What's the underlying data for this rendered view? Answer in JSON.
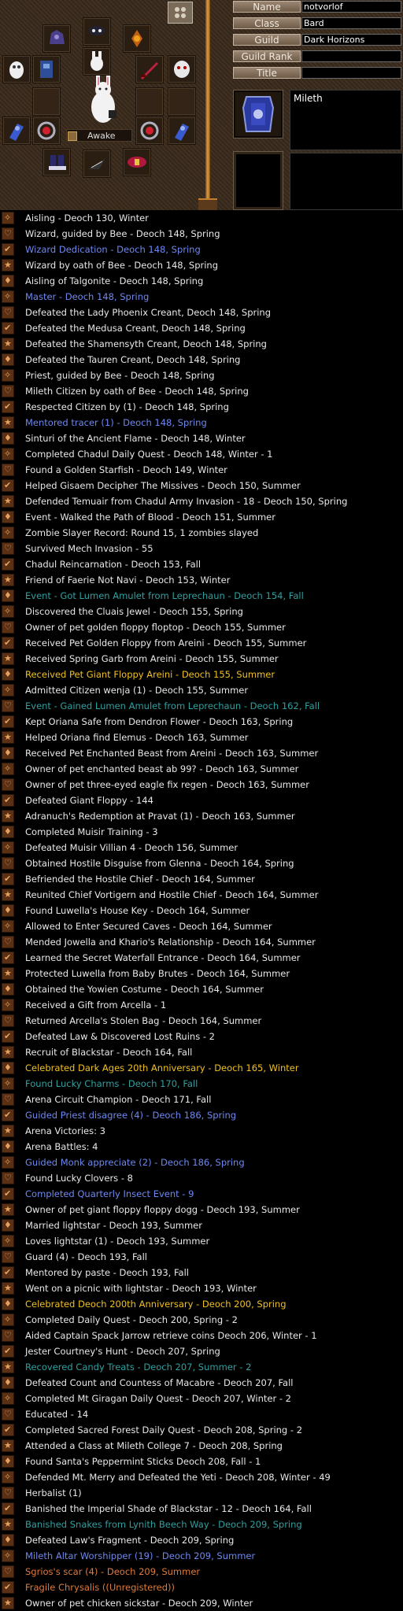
{
  "profile": {
    "labels": {
      "name": "Name",
      "class": "Class",
      "guild": "Guild",
      "guild_rank": "Guild Rank",
      "title": "Title"
    },
    "values": {
      "name": "notvorlof",
      "class": "Bard",
      "guild": "Dark Horizons",
      "guild_rank": "",
      "title": ""
    },
    "nation": "Mileth",
    "status": "Awake"
  },
  "legend": [
    {
      "text": "Aisling - Deoch 130, Winter",
      "color": "w"
    },
    {
      "text": "Wizard, guided by Bee - Deoch 148, Spring",
      "color": "w"
    },
    {
      "text": "Wizard Dedication - Deoch 148, Spring",
      "color": "b"
    },
    {
      "text": "Wizard by oath of Bee - Deoch 148, Spring",
      "color": "w"
    },
    {
      "text": "Aisling of Talgonite - Deoch 148, Spring",
      "color": "w"
    },
    {
      "text": "Master - Deoch 148, Spring",
      "color": "b"
    },
    {
      "text": "Defeated the Lady Phoenix Creant, Deoch 148, Spring",
      "color": "w"
    },
    {
      "text": "Defeated the Medusa Creant, Deoch 148, Spring",
      "color": "w"
    },
    {
      "text": "Defeated the Shamensyth Creant, Deoch 148, Spring",
      "color": "w"
    },
    {
      "text": "Defeated the Tauren Creant, Deoch 148, Spring",
      "color": "w"
    },
    {
      "text": "Priest, guided by Bee - Deoch 148, Spring",
      "color": "w"
    },
    {
      "text": "Mileth Citizen by oath of Bee - Deoch 148, Spring",
      "color": "w"
    },
    {
      "text": "Respected Citizen by  (1) - Deoch 148, Spring",
      "color": "w"
    },
    {
      "text": "Mentored tracer (1) - Deoch 148, Spring",
      "color": "b"
    },
    {
      "text": "Sinturi of the Ancient Flame - Deoch 148, Winter",
      "color": "w"
    },
    {
      "text": "Completed Chadul Daily Quest - Deoch 148, Winter - 1",
      "color": "w"
    },
    {
      "text": "Found a Golden Starfish - Deoch 149, Winter",
      "color": "w"
    },
    {
      "text": "Helped Gisaem Decipher The Missives - Deoch 150, Summer",
      "color": "w"
    },
    {
      "text": "Defended Temuair from Chadul Army Invasion - 18 - Deoch 150, Spring",
      "color": "w"
    },
    {
      "text": "Event - Walked the Path of Blood - Deoch 151, Summer",
      "color": "w"
    },
    {
      "text": "Zombie Slayer Record: Round 15, 1 zombies slayed",
      "color": "w"
    },
    {
      "text": "Survived Mech Invasion - 55",
      "color": "w"
    },
    {
      "text": "Chadul Reincarnation - Deoch 153, Fall",
      "color": "w"
    },
    {
      "text": "Friend of Faerie Not Navi - Deoch 153, Winter",
      "color": "w"
    },
    {
      "text": "Event - Got Lumen Amulet from Leprechaun - Deoch 154, Fall",
      "color": "t"
    },
    {
      "text": "Discovered the Cluais Jewel - Deoch 155, Spring",
      "color": "w"
    },
    {
      "text": "Owner of pet golden floppy floptop - Deoch 155, Summer",
      "color": "w"
    },
    {
      "text": "Received Pet Golden Floppy from Areini - Deoch 155, Summer",
      "color": "w"
    },
    {
      "text": "Received Spring Garb from Areini - Deoch 155, Summer",
      "color": "w"
    },
    {
      "text": "Received Pet Giant Floppy Areini - Deoch 155, Summer",
      "color": "y"
    },
    {
      "text": "Admitted Citizen wenja (1) - Deoch 155, Summer",
      "color": "w"
    },
    {
      "text": "Event - Gained Lumen Amulet from Leprechaun - Deoch 162, Fall",
      "color": "t"
    },
    {
      "text": "Kept Oriana Safe from Dendron Flower - Deoch 163, Spring",
      "color": "w"
    },
    {
      "text": "Helped Oriana find Elemus - Deoch 163, Summer",
      "color": "w"
    },
    {
      "text": "Received Pet Enchanted Beast from Areini - Deoch 163, Summer",
      "color": "w"
    },
    {
      "text": "Owner of pet enchanted beast ab 99? - Deoch 163, Summer",
      "color": "w"
    },
    {
      "text": "Owner of pet three-eyed eagle fix regen - Deoch 163, Summer",
      "color": "w"
    },
    {
      "text": "Defeated Giant Floppy - 144",
      "color": "w"
    },
    {
      "text": "Adranuch's Redemption at Pravat (1) - Deoch 163, Summer",
      "color": "w"
    },
    {
      "text": "Completed Muisir Training - 3",
      "color": "w"
    },
    {
      "text": "Defeated Muisir Villian 4 - Deoch 156, Summer",
      "color": "w"
    },
    {
      "text": "Obtained Hostile Disguise from Glenna - Deoch 164, Spring",
      "color": "w"
    },
    {
      "text": "Befriended the Hostile Chief - Deoch 164, Summer",
      "color": "w"
    },
    {
      "text": "Reunited Chief Vortigern and Hostile Chief - Deoch 164, Summer",
      "color": "w"
    },
    {
      "text": "Found Luwella's House Key - Deoch 164, Summer",
      "color": "w"
    },
    {
      "text": "Allowed to Enter Secured Caves - Deoch 164, Summer",
      "color": "w"
    },
    {
      "text": "Mended Jowella and Khario's Relationship - Deoch 164, Summer",
      "color": "w"
    },
    {
      "text": "Learned the Secret Waterfall Entrance - Deoch 164, Summer",
      "color": "w"
    },
    {
      "text": "Protected Luwella from Baby Brutes - Deoch 164, Summer",
      "color": "w"
    },
    {
      "text": "Obtained the Yowien Costume - Deoch 164, Summer",
      "color": "w"
    },
    {
      "text": "Received a Gift from Arcella - 1",
      "color": "w"
    },
    {
      "text": "Returned Arcella's Stolen Bag - Deoch 164, Summer",
      "color": "w"
    },
    {
      "text": "Defeated Law & Discovered Lost Ruins - 2",
      "color": "w"
    },
    {
      "text": "Recruit of Blackstar - Deoch 164, Fall",
      "color": "w"
    },
    {
      "text": "Celebrated Dark Ages 20th Anniversary - Deoch 165, Winter",
      "color": "y"
    },
    {
      "text": "Found Lucky Charms - Deoch 170, Fall",
      "color": "t"
    },
    {
      "text": "Arena Circuit Champion - Deoch 171, Fall",
      "color": "w"
    },
    {
      "text": "Guided Priest disagree (4) - Deoch 186, Spring",
      "color": "b"
    },
    {
      "text": "Arena Victories: 3",
      "color": "w"
    },
    {
      "text": "Arena Battles: 4",
      "color": "w"
    },
    {
      "text": "Guided Monk appreciate (2) - Deoch 186, Spring",
      "color": "b"
    },
    {
      "text": "Found Lucky Clovers - 8",
      "color": "w"
    },
    {
      "text": "Completed Quarterly Insect Event - 9",
      "color": "b"
    },
    {
      "text": "Owner of pet giant floppy floppy dogg - Deoch 193, Summer",
      "color": "w"
    },
    {
      "text": "Married lightstar - Deoch 193, Summer",
      "color": "w"
    },
    {
      "text": "Loves lightstar (1) - Deoch 193, Summer",
      "color": "w"
    },
    {
      "text": "Guard (4) - Deoch 193, Fall",
      "color": "w"
    },
    {
      "text": "Mentored by paste - Deoch 193, Fall",
      "color": "w"
    },
    {
      "text": "Went on a picnic with lightstar - Deoch 193, Winter",
      "color": "w"
    },
    {
      "text": "Celebrated Deoch 200th Anniversary - Deoch 200, Spring",
      "color": "y"
    },
    {
      "text": "Completed Daily Quest - Deoch 200, Spring - 2",
      "color": "w"
    },
    {
      "text": "Aided Captain Spack Jarrow retrieve coins  Deoch 206, Winter - 1",
      "color": "w"
    },
    {
      "text": "Jester Courtney's Hunt - Deoch 207, Spring",
      "color": "w"
    },
    {
      "text": "Recovered Candy Treats - Deoch 207, Summer - 2",
      "color": "t"
    },
    {
      "text": "Defeated Count and Countess of Macabre - Deoch 207, Fall",
      "color": "w"
    },
    {
      "text": "Completed Mt Giragan Daily Quest - Deoch 207, Winter - 2",
      "color": "w"
    },
    {
      "text": "Educated - 14",
      "color": "w"
    },
    {
      "text": "Completed Sacred Forest Daily Quest - Deoch 208, Spring - 2",
      "color": "w"
    },
    {
      "text": "Attended a Class at Mileth College 7 - Deoch 208, Spring",
      "color": "w"
    },
    {
      "text": "Found Santa's Peppermint Sticks  Deoch 208, Fall - 1",
      "color": "w"
    },
    {
      "text": "Defended Mt. Merry and Defeated the Yeti - Deoch 208, Winter - 49",
      "color": "w"
    },
    {
      "text": "Herbalist (1)",
      "color": "w"
    },
    {
      "text": "Banished the Imperial Shade of Blackstar - 12 - Deoch 164, Fall",
      "color": "w"
    },
    {
      "text": "Banished Snakes from Lynith Beech Way - Deoch 209, Spring",
      "color": "t"
    },
    {
      "text": "Defeated Law's Fragment - Deoch 209, Spring",
      "color": "w"
    },
    {
      "text": "Mileth Altar Worshipper (19) - Deoch 209, Summer",
      "color": "b"
    },
    {
      "text": "Sgrios's scar (4) - Deoch 209, Summer",
      "color": "o"
    },
    {
      "text": "Fragile Chrysalis ((Unregistered))",
      "color": "o"
    },
    {
      "text": "Owner of pet chicken sickstar - Deoch 209, Winter",
      "color": "w"
    }
  ]
}
